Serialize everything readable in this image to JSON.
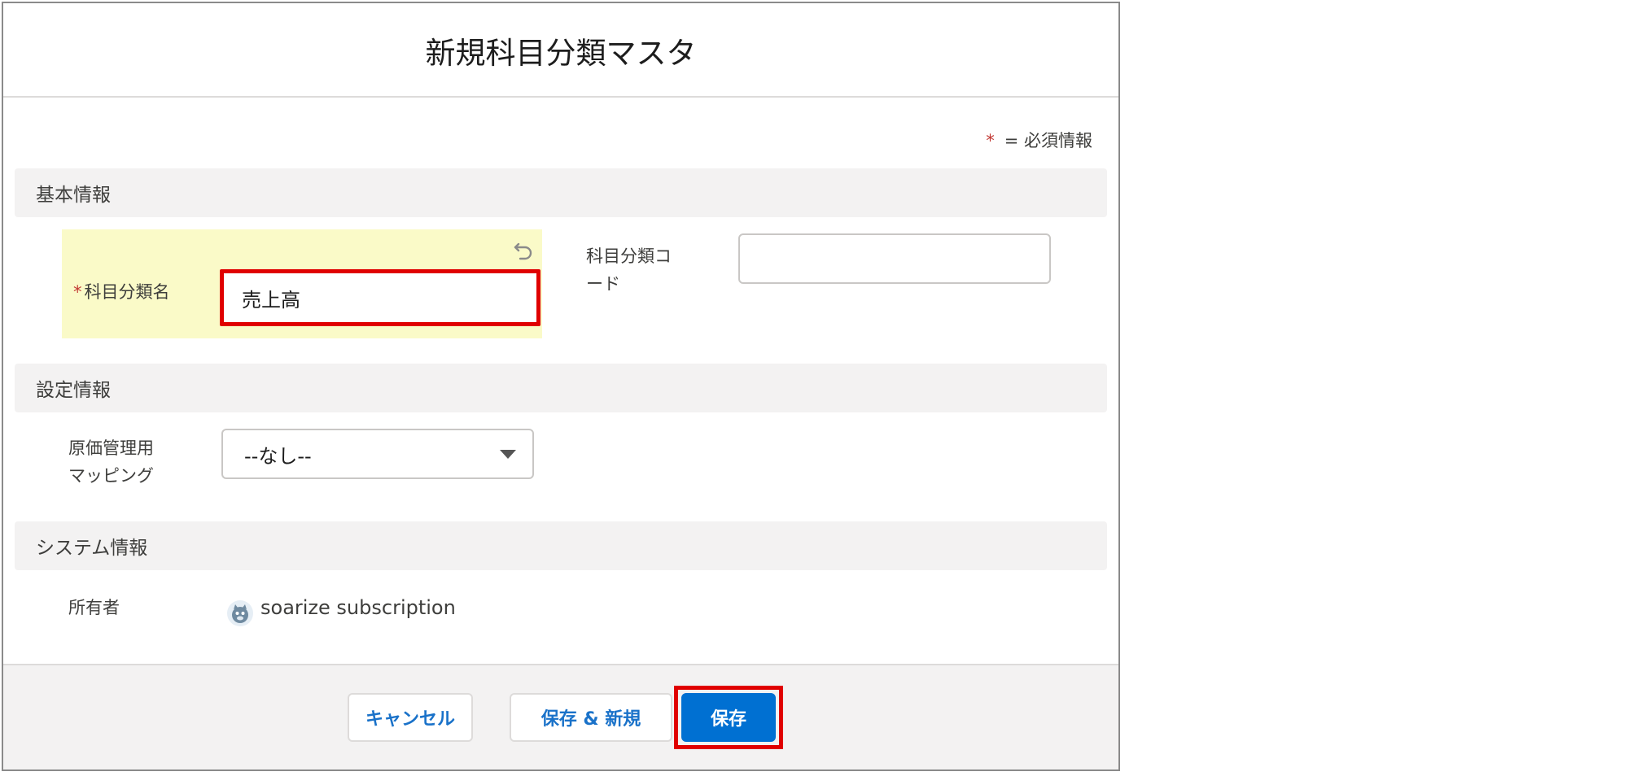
{
  "modal": {
    "title": "新規科目分類マスタ"
  },
  "required_note": {
    "star": "*",
    "text": "= 必須情報"
  },
  "sections": {
    "basic": "基本情報",
    "settings": "設定情報",
    "system": "システム情報"
  },
  "fields": {
    "category_name": {
      "star": "*",
      "label": "科目分類名",
      "value": "売上高"
    },
    "category_code": {
      "label_line1": "科目分類コ",
      "label_line2": "ード",
      "value": ""
    },
    "cost_mapping": {
      "label_line1": "原価管理用",
      "label_line2": "マッピング",
      "value": "--なし--"
    },
    "owner": {
      "label": "所有者",
      "value": "soarize subscription"
    }
  },
  "footer": {
    "cancel": "キャンセル",
    "save_new": "保存 & 新規",
    "save": "保存"
  },
  "colors": {
    "highlight": "#fafac8",
    "annotation_red": "#e00000",
    "primary_blue": "#0070d2",
    "required_red": "#c23934"
  },
  "icons": {
    "undo": "undo-icon",
    "dropdown": "chevron-down-icon",
    "avatar": "user-avatar-icon"
  }
}
